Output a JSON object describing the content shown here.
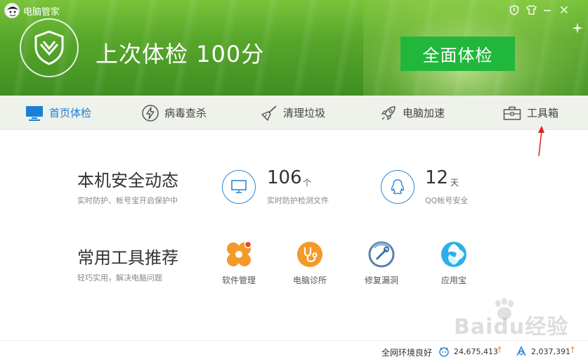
{
  "window": {
    "title": "电脑管家"
  },
  "header": {
    "last_check": "上次体检 100分",
    "full_check_button": "全面体检"
  },
  "nav": {
    "items": [
      {
        "label": "首页体检",
        "icon": "monitor-icon",
        "active": true
      },
      {
        "label": "病毒查杀",
        "icon": "lightning-icon",
        "active": false
      },
      {
        "label": "清理垃圾",
        "icon": "broom-icon",
        "active": false
      },
      {
        "label": "电脑加速",
        "icon": "rocket-icon",
        "active": false
      },
      {
        "label": "工具箱",
        "icon": "toolbox-icon",
        "active": false
      }
    ]
  },
  "security": {
    "title": "本机安全动态",
    "subtitle": "实时防护、帐号宝开启保护中",
    "stats": [
      {
        "value": "106",
        "unit": "个",
        "desc": "实时防护检测文件",
        "icon": "monitor-icon"
      },
      {
        "value": "12",
        "unit": "天",
        "desc": "QQ帐号安全",
        "icon": "qq-penguin-icon"
      }
    ]
  },
  "tools": {
    "title": "常用工具推荐",
    "subtitle": "轻巧实用，解决电脑问题",
    "items": [
      {
        "label": "软件管理",
        "icon": "software-manager-icon"
      },
      {
        "label": "电脑诊所",
        "icon": "stethoscope-icon"
      },
      {
        "label": "修复漏洞",
        "icon": "repair-icon"
      },
      {
        "label": "应用宝",
        "icon": "app-store-icon"
      }
    ]
  },
  "footer": {
    "status": "全网环境良好",
    "count1": "24,675,413",
    "count2": "2,037,391",
    "up_symbol": "↑"
  },
  "watermark": {
    "text": "Baidu经验"
  },
  "colors": {
    "accent_blue": "#1a7fd6",
    "button_green": "#21b73c",
    "annotation_red": "#e02020",
    "up_orange": "#f08a1a"
  }
}
